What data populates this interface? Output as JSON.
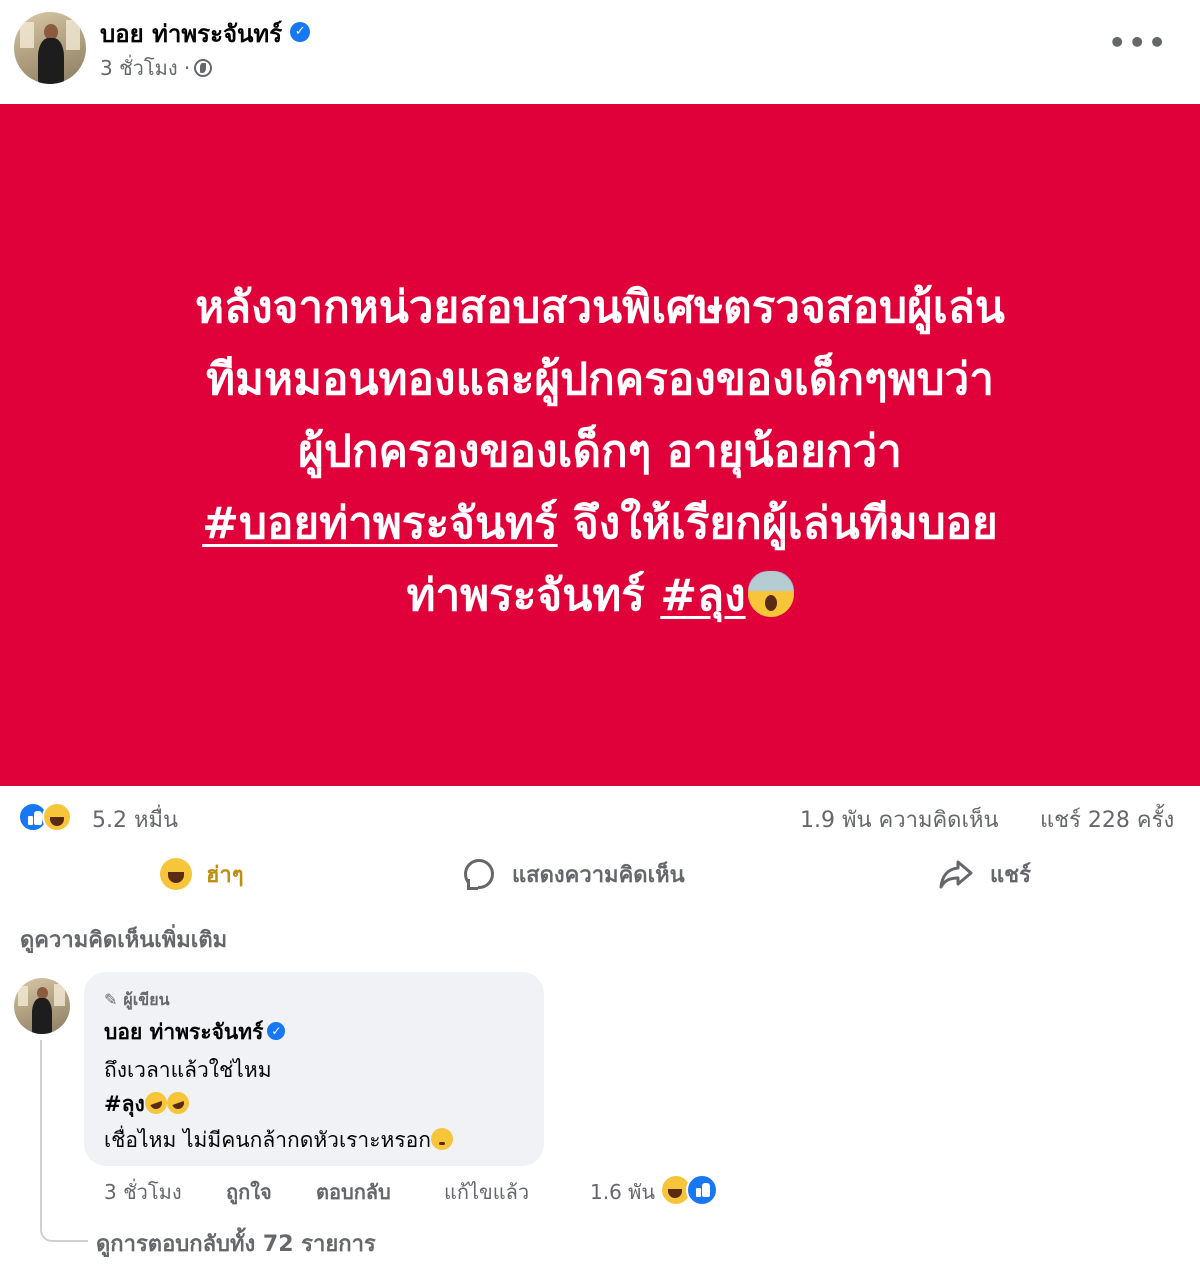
{
  "post": {
    "author": "บอย ท่าพระจันทร์",
    "time": "3 ชั่วโมง ·",
    "more_icon": "more-horizontal-icon",
    "more_label": "•••",
    "panel_color": "#e0003a",
    "text_lines": [
      "หลังจากหน่วยสอบสวนพิเศษตรวจสอบผู้เล่น",
      "ทีมหมอนทองและผู้ปกครองของเด็กๆพบว่า",
      "ผู้ปกครองของเด็กๆ อายุน้อยกว่า"
    ],
    "hashtag_main": "#บอยท่าพระจันทร์",
    "line4_rest": " จึงให้เรียกผู้เล่นทีมบอย",
    "line5_text": "ท่าพระจันทร์ ",
    "hashtag_uncle": "#ลุง"
  },
  "stats": {
    "reactions": "5.2 หมื่น",
    "comments": "1.9 พัน ความคิดเห็น",
    "shares": "แชร์ 228 ครั้ง"
  },
  "actions": {
    "haha": "ฮ่าๆ",
    "comment": "แสดงความคิดเห็น",
    "share": "แชร์"
  },
  "comments_section": {
    "more_comments": "ดูความคิดเห็นเพิ่มเติม",
    "comment": {
      "author_tag": "ผู้เขียน",
      "author": "บอย ท่าพระจันทร์",
      "line1": "ถึงเวลาแล้วใช่ไหม",
      "line2": "#ลุง",
      "line3": "เชื่อไหม ไม่มีคนกล้ากดหัวเราะหรอก",
      "time": "3 ชั่วโมง",
      "like": "ถูกใจ",
      "reply": "ตอบกลับ",
      "edited": "แก้ไขแล้ว",
      "reaction_count": "1.6 พัน"
    },
    "view_replies": "ดูการตอบกลับทั้ง 72 รายการ"
  }
}
